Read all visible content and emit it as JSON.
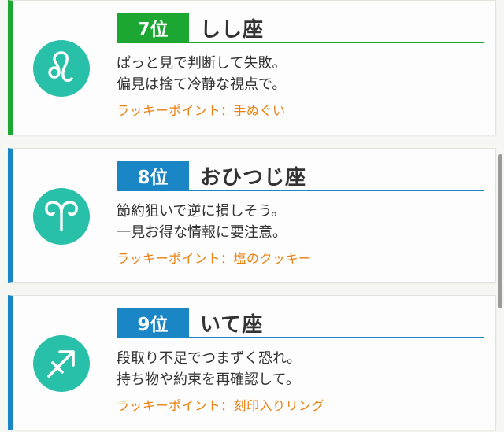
{
  "colors": {
    "green": "#1ca632",
    "blue": "#1a86c6",
    "teal": "#29c0a9",
    "orange": "#e8800f"
  },
  "cards": [
    {
      "rank": "7位",
      "sign": "しし座",
      "icon": "leo-icon",
      "line1": "ぱっと見で判断して失敗。",
      "line2": "偏見は捨て冷静な視点で。",
      "lucky": "ラッキーポイント：手ぬぐい"
    },
    {
      "rank": "8位",
      "sign": "おひつじ座",
      "icon": "aries-icon",
      "line1": "節約狙いで逆に損しそう。",
      "line2": "一見お得な情報に要注意。",
      "lucky": "ラッキーポイント：塩のクッキー"
    },
    {
      "rank": "9位",
      "sign": "いて座",
      "icon": "sagittarius-icon",
      "line1": "段取り不足でつまずく恐れ。",
      "line2": "持ち物や約束を再確認して。",
      "lucky": "ラッキーポイント：刻印入りリング"
    }
  ]
}
